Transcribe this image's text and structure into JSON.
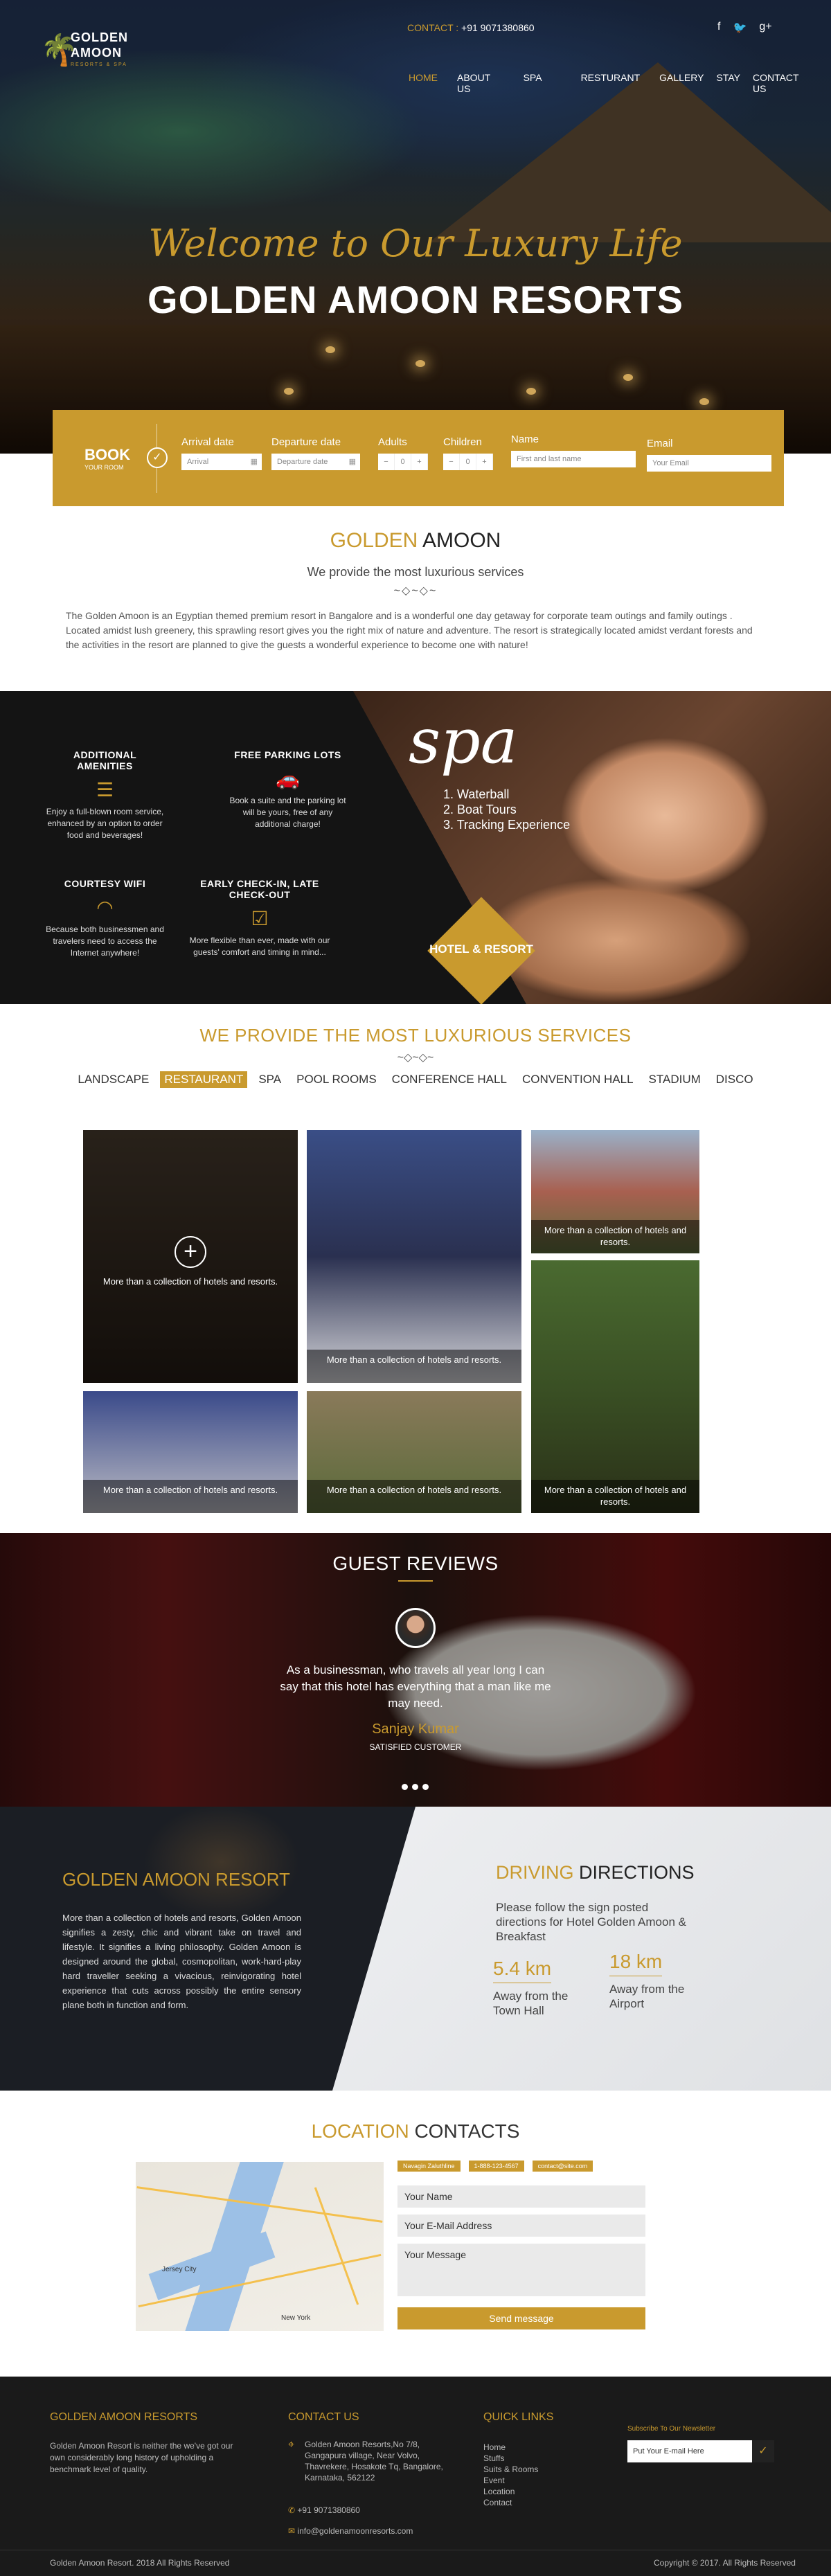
{
  "colors": {
    "accent": "#c99a2e",
    "dark": "#1a1a1a",
    "hero_dark": "#1e2d3f"
  },
  "header": {
    "logo_line1": "GOLDEN",
    "logo_line2": "AMOON",
    "logo_tag": "RESORTS & SPA",
    "contact_label": "CONTACT :",
    "contact_phone": "+91 9071380860",
    "social": [
      "facebook-icon",
      "twitter-icon",
      "google-plus-icon"
    ],
    "nav": [
      "HOME",
      "ABOUT US",
      "SPA",
      "RESTURANT",
      "GALLERY",
      "STAY",
      "CONTACT US"
    ]
  },
  "hero": {
    "welcome": "Welcome to Our Luxury Life",
    "title": "GOLDEN AMOON RESORTS"
  },
  "booking": {
    "book": "BOOK",
    "your_room": "YOUR ROOM",
    "arrival_label": "Arrival date",
    "arrival_value": "Arrival",
    "departure_label": "Departure date",
    "departure_value": "Departure date",
    "adults_label": "Adults",
    "adults_value": "0",
    "children_label": "Children",
    "children_value": "0",
    "name_label": "Name",
    "name_placeholder": "First and last name",
    "email_label": "Email",
    "email_placeholder": "Your Email"
  },
  "about": {
    "title_a": "GOLDEN",
    "title_b": "AMOON",
    "subtitle": "We provide the most luxurious services",
    "text": "The Golden Amoon is an Egyptian themed premium resort in Bangalore and is a wonderful one day getaway for corporate team outings and family outings . Located amidst lush greenery, this sprawling resort gives you the right mix of nature and adventure. The resort is strategically located amidst verdant forests and the activities in the resort are planned to give the guests a wonderful experience to become one with nature!"
  },
  "features": [
    {
      "title": "ADDITIONAL AMENITIES",
      "icon": "list-icon",
      "text": "Enjoy a full-blown room service, enhanced by an option to order food and beverages!"
    },
    {
      "title": "FREE PARKING LOTS",
      "icon": "car-icon",
      "text": "Book a suite and the parking lot will be yours, free of any additional charge!"
    },
    {
      "title": "COURTESY WIFI",
      "icon": "wifi-icon",
      "text": "Because both businessmen and travelers need to access the Internet anywhere!"
    },
    {
      "title": "EARLY CHECK-IN, LATE CHECK-OUT",
      "icon": "check-icon",
      "text": "More flexible than ever, made with our guests' comfort and timing in mind..."
    }
  ],
  "spa": {
    "word": "spa",
    "items": [
      "1. Waterball",
      "2. Boat Tours",
      "3. Tracking Experience"
    ],
    "badge": "HOTEL & RESORT"
  },
  "services": {
    "title": "WE PROVIDE THE MOST LUXURIOUS SERVICES",
    "tabs": [
      "LANDSCAPE",
      "RESTAURANT",
      "SPA",
      "POOL ROOMS",
      "CONFERENCE HALL",
      "CONVENTION HALL",
      "STADIUM",
      "DISCO"
    ],
    "active_tab": "RESTAURANT",
    "caption": "More than a collection of hotels and resorts."
  },
  "reviews": {
    "title": "GUEST REVIEWS",
    "quote": "As a businessman, who travels all year long I can say that this hotel has everything that a man like me may need.",
    "name": "Sanjay Kumar",
    "role": "SATISFIED CUSTOMER"
  },
  "resort": {
    "title": "GOLDEN AMOON RESORT",
    "text": "More than a collection of hotels and resorts, Golden Amoon signifies a zesty, chic and vibrant take on travel and lifestyle. It signifies a living philosophy. Golden Amoon is designed around the global, cosmopolitan, work-hard-play hard traveller seeking a vivacious, reinvigorating hotel experience that cuts across possibly the entire sensory plane both in function and form.",
    "driving_a": "DRIVING",
    "driving_b": "DIRECTIONS",
    "driving_text": "Please follow the sign posted directions for Hotel Golden Amoon & Breakfast",
    "dist1_km": "5.4 km",
    "dist1_text": "Away from the Town Hall",
    "dist2_km": "18 km",
    "dist2_text": "Away from the Airport"
  },
  "contacts": {
    "title_a": "LOCATION",
    "title_b": "CONTACTS",
    "pills": [
      "Navagin Zaluthline",
      "1-888-123-4567",
      "contact@site.com"
    ],
    "map_labels": [
      "Jersey City",
      "New York"
    ],
    "name": "Your Name",
    "email": "Your E-Mail Address",
    "message": "Your Message",
    "send": "Send message"
  },
  "footer": {
    "col1_title": "GOLDEN AMOON RESORTS",
    "col1_text": "Golden Amoon Resort is neither the we've got our own considerably long history of upholding a benchmark level of quality.",
    "col2_title": "CONTACT US",
    "address": "Golden Amoon Resorts,No 7/8, Gangapura village, Near Volvo, Thavrekere, Hosakote Tq, Bangalore, Karnataka, 562122",
    "phone": "+91 9071380860",
    "email": "info@goldenamoonresorts.com",
    "col3_title": "QUICK LINKS",
    "links": [
      "Home",
      "Stuffs",
      "Suits & Rooms",
      "Event",
      "Location",
      "Contact"
    ],
    "newsletter": "Subscribe To Our Newsletter",
    "newsletter_placeholder": "Put Your E-mail Here",
    "copyright_left": "Golden Amoon Resort. 2018 All Rights Reserved",
    "copyright_right": "Copyright © 2017. All Rights Reserved"
  }
}
